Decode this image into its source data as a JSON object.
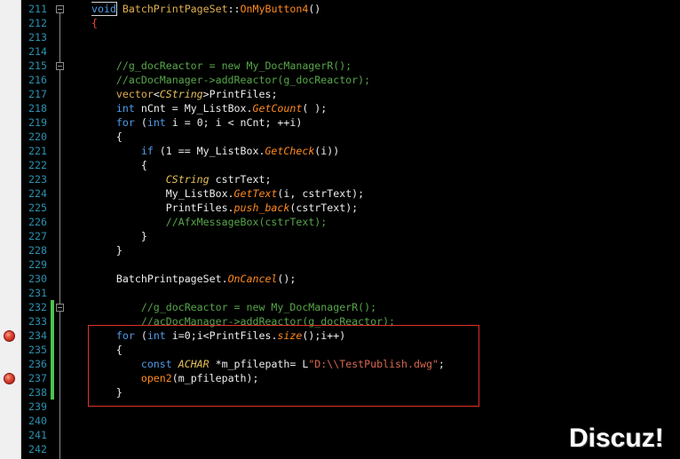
{
  "editor": {
    "lines": [
      {
        "num": "211",
        "tokens": [
          {
            "hl": "void"
          },
          {
            "pl": " "
          },
          {
            "cls": "BatchPrintPageSet"
          },
          {
            "pl": "::"
          },
          {
            "gfn": "OnMyButton4"
          },
          {
            "pl": "()"
          }
        ]
      },
      {
        "num": "212",
        "tokens": [
          {
            "br": "{"
          }
        ]
      },
      {
        "num": "213",
        "tokens": []
      },
      {
        "num": "214",
        "tokens": []
      },
      {
        "num": "215",
        "tokens": [
          {
            "pl": "    "
          },
          {
            "cm": "//g_docReactor = new My_DocManagerR();"
          }
        ]
      },
      {
        "num": "216",
        "tokens": [
          {
            "pl": "    "
          },
          {
            "cm": "//acDocManager->addReactor(g_docReactor);"
          }
        ]
      },
      {
        "num": "217",
        "tokens": [
          {
            "pl": "    "
          },
          {
            "cls": "vector"
          },
          {
            "pl": "<"
          },
          {
            "ty": "CString"
          },
          {
            "pl": ">PrintFiles;"
          }
        ]
      },
      {
        "num": "218",
        "tokens": [
          {
            "pl": "    "
          },
          {
            "kw": "int"
          },
          {
            "pl": " nCnt = My_ListBox."
          },
          {
            "fn": "GetCount"
          },
          {
            "pl": "( );"
          }
        ]
      },
      {
        "num": "219",
        "tokens": [
          {
            "pl": "    "
          },
          {
            "kw": "for"
          },
          {
            "pl": " ("
          },
          {
            "kw": "int"
          },
          {
            "pl": " i = 0; i < nCnt; ++i)"
          }
        ]
      },
      {
        "num": "220",
        "tokens": [
          {
            "pl": "    {"
          }
        ]
      },
      {
        "num": "221",
        "tokens": [
          {
            "pl": "        "
          },
          {
            "kw": "if"
          },
          {
            "pl": " (1 == My_ListBox."
          },
          {
            "fn": "GetCheck"
          },
          {
            "pl": "(i))"
          }
        ]
      },
      {
        "num": "222",
        "tokens": [
          {
            "pl": "        {"
          }
        ]
      },
      {
        "num": "223",
        "tokens": [
          {
            "pl": "            "
          },
          {
            "ty": "CString"
          },
          {
            "pl": " cstrText;"
          }
        ]
      },
      {
        "num": "224",
        "tokens": [
          {
            "pl": "            My_ListBox."
          },
          {
            "fn": "GetText"
          },
          {
            "pl": "(i, cstrText);"
          }
        ]
      },
      {
        "num": "225",
        "tokens": [
          {
            "pl": "            PrintFiles."
          },
          {
            "fn": "push_back"
          },
          {
            "pl": "(cstrText);"
          }
        ]
      },
      {
        "num": "226",
        "tokens": [
          {
            "pl": "            "
          },
          {
            "cm": "//AfxMessageBox(cstrText);"
          }
        ]
      },
      {
        "num": "227",
        "tokens": [
          {
            "pl": "        }"
          }
        ]
      },
      {
        "num": "228",
        "tokens": [
          {
            "pl": "    }"
          }
        ]
      },
      {
        "num": "229",
        "tokens": []
      },
      {
        "num": "230",
        "tokens": [
          {
            "pl": "    BatchPrintpageSet."
          },
          {
            "fn": "OnCancel"
          },
          {
            "pl": "();"
          }
        ]
      },
      {
        "num": "231",
        "tokens": []
      },
      {
        "num": "232",
        "tokens": [
          {
            "pl": "        "
          },
          {
            "cm": "//g_docReactor = new My_DocManagerR();"
          }
        ]
      },
      {
        "num": "233",
        "tokens": [
          {
            "pl": "        "
          },
          {
            "cm": "//acDocManager->addReactor(g_docReactor);"
          }
        ]
      },
      {
        "num": "234",
        "tokens": [
          {
            "pl": "    "
          },
          {
            "kw": "for"
          },
          {
            "pl": " ("
          },
          {
            "kw": "int"
          },
          {
            "pl": " i=0;i<PrintFiles."
          },
          {
            "fn": "size"
          },
          {
            "pl": "();i++)"
          }
        ]
      },
      {
        "num": "235",
        "tokens": [
          {
            "pl": "    {"
          }
        ]
      },
      {
        "num": "236",
        "tokens": [
          {
            "pl": "        "
          },
          {
            "kw": "const"
          },
          {
            "pl": " "
          },
          {
            "ty": "ACHAR"
          },
          {
            "pl": " *m_pfilepath= L"
          },
          {
            "str": "\"D:\\\\TestPublish.dwg\""
          },
          {
            "pl": ";"
          }
        ]
      },
      {
        "num": "237",
        "tokens": [
          {
            "pl": "        "
          },
          {
            "gfn": "open2"
          },
          {
            "pl": "(m_pfilepath);"
          }
        ]
      },
      {
        "num": "238",
        "tokens": [
          {
            "pl": "    }"
          }
        ]
      },
      {
        "num": "239",
        "tokens": []
      },
      {
        "num": "240",
        "tokens": []
      },
      {
        "num": "241",
        "tokens": []
      },
      {
        "num": "242",
        "tokens": []
      }
    ],
    "breakpoint_lines": [
      234,
      237
    ],
    "changed_lines": {
      "from": 232,
      "to": 238
    },
    "outline_markers": [
      211,
      215,
      232
    ]
  },
  "watermark": {
    "text": "Discuz!"
  },
  "icons": {
    "breakpoint": "breakpoint-icon",
    "collapse": "collapse-icon"
  },
  "colors": {
    "background": "#000000",
    "margin": "#F0F0F0",
    "line_number": "#2B91AF",
    "plain": "#EDEDED",
    "keyword": "#4F9CE8",
    "highlight_border": "#D4D4D4",
    "comment": "#57A64A",
    "function": "#FF8A1E",
    "type": "#E6C05A",
    "class": "#E0AE50",
    "string": "#D8674F",
    "brace": "#F0453A",
    "changed_bar": "#4FC14F",
    "outline": "#8C8C8C",
    "annotation_box": "#E0302A",
    "breakpoint": "#C42A1E",
    "watermark": "#FFFFFF"
  }
}
